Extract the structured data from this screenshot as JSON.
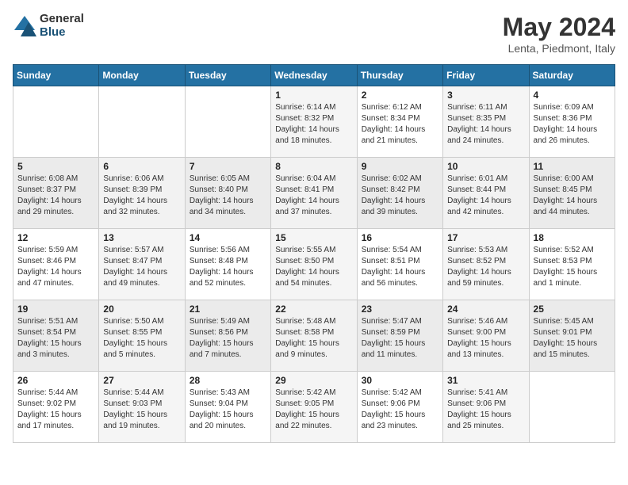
{
  "header": {
    "logo_general": "General",
    "logo_blue": "Blue",
    "title": "May 2024",
    "subtitle": "Lenta, Piedmont, Italy"
  },
  "days_of_week": [
    "Sunday",
    "Monday",
    "Tuesday",
    "Wednesday",
    "Thursday",
    "Friday",
    "Saturday"
  ],
  "weeks": [
    [
      {
        "day": "",
        "info": ""
      },
      {
        "day": "",
        "info": ""
      },
      {
        "day": "",
        "info": ""
      },
      {
        "day": "1",
        "info": "Sunrise: 6:14 AM\nSunset: 8:32 PM\nDaylight: 14 hours\nand 18 minutes."
      },
      {
        "day": "2",
        "info": "Sunrise: 6:12 AM\nSunset: 8:34 PM\nDaylight: 14 hours\nand 21 minutes."
      },
      {
        "day": "3",
        "info": "Sunrise: 6:11 AM\nSunset: 8:35 PM\nDaylight: 14 hours\nand 24 minutes."
      },
      {
        "day": "4",
        "info": "Sunrise: 6:09 AM\nSunset: 8:36 PM\nDaylight: 14 hours\nand 26 minutes."
      }
    ],
    [
      {
        "day": "5",
        "info": "Sunrise: 6:08 AM\nSunset: 8:37 PM\nDaylight: 14 hours\nand 29 minutes."
      },
      {
        "day": "6",
        "info": "Sunrise: 6:06 AM\nSunset: 8:39 PM\nDaylight: 14 hours\nand 32 minutes."
      },
      {
        "day": "7",
        "info": "Sunrise: 6:05 AM\nSunset: 8:40 PM\nDaylight: 14 hours\nand 34 minutes."
      },
      {
        "day": "8",
        "info": "Sunrise: 6:04 AM\nSunset: 8:41 PM\nDaylight: 14 hours\nand 37 minutes."
      },
      {
        "day": "9",
        "info": "Sunrise: 6:02 AM\nSunset: 8:42 PM\nDaylight: 14 hours\nand 39 minutes."
      },
      {
        "day": "10",
        "info": "Sunrise: 6:01 AM\nSunset: 8:44 PM\nDaylight: 14 hours\nand 42 minutes."
      },
      {
        "day": "11",
        "info": "Sunrise: 6:00 AM\nSunset: 8:45 PM\nDaylight: 14 hours\nand 44 minutes."
      }
    ],
    [
      {
        "day": "12",
        "info": "Sunrise: 5:59 AM\nSunset: 8:46 PM\nDaylight: 14 hours\nand 47 minutes."
      },
      {
        "day": "13",
        "info": "Sunrise: 5:57 AM\nSunset: 8:47 PM\nDaylight: 14 hours\nand 49 minutes."
      },
      {
        "day": "14",
        "info": "Sunrise: 5:56 AM\nSunset: 8:48 PM\nDaylight: 14 hours\nand 52 minutes."
      },
      {
        "day": "15",
        "info": "Sunrise: 5:55 AM\nSunset: 8:50 PM\nDaylight: 14 hours\nand 54 minutes."
      },
      {
        "day": "16",
        "info": "Sunrise: 5:54 AM\nSunset: 8:51 PM\nDaylight: 14 hours\nand 56 minutes."
      },
      {
        "day": "17",
        "info": "Sunrise: 5:53 AM\nSunset: 8:52 PM\nDaylight: 14 hours\nand 59 minutes."
      },
      {
        "day": "18",
        "info": "Sunrise: 5:52 AM\nSunset: 8:53 PM\nDaylight: 15 hours\nand 1 minute."
      }
    ],
    [
      {
        "day": "19",
        "info": "Sunrise: 5:51 AM\nSunset: 8:54 PM\nDaylight: 15 hours\nand 3 minutes."
      },
      {
        "day": "20",
        "info": "Sunrise: 5:50 AM\nSunset: 8:55 PM\nDaylight: 15 hours\nand 5 minutes."
      },
      {
        "day": "21",
        "info": "Sunrise: 5:49 AM\nSunset: 8:56 PM\nDaylight: 15 hours\nand 7 minutes."
      },
      {
        "day": "22",
        "info": "Sunrise: 5:48 AM\nSunset: 8:58 PM\nDaylight: 15 hours\nand 9 minutes."
      },
      {
        "day": "23",
        "info": "Sunrise: 5:47 AM\nSunset: 8:59 PM\nDaylight: 15 hours\nand 11 minutes."
      },
      {
        "day": "24",
        "info": "Sunrise: 5:46 AM\nSunset: 9:00 PM\nDaylight: 15 hours\nand 13 minutes."
      },
      {
        "day": "25",
        "info": "Sunrise: 5:45 AM\nSunset: 9:01 PM\nDaylight: 15 hours\nand 15 minutes."
      }
    ],
    [
      {
        "day": "26",
        "info": "Sunrise: 5:44 AM\nSunset: 9:02 PM\nDaylight: 15 hours\nand 17 minutes."
      },
      {
        "day": "27",
        "info": "Sunrise: 5:44 AM\nSunset: 9:03 PM\nDaylight: 15 hours\nand 19 minutes."
      },
      {
        "day": "28",
        "info": "Sunrise: 5:43 AM\nSunset: 9:04 PM\nDaylight: 15 hours\nand 20 minutes."
      },
      {
        "day": "29",
        "info": "Sunrise: 5:42 AM\nSunset: 9:05 PM\nDaylight: 15 hours\nand 22 minutes."
      },
      {
        "day": "30",
        "info": "Sunrise: 5:42 AM\nSunset: 9:06 PM\nDaylight: 15 hours\nand 23 minutes."
      },
      {
        "day": "31",
        "info": "Sunrise: 5:41 AM\nSunset: 9:06 PM\nDaylight: 15 hours\nand 25 minutes."
      },
      {
        "day": "",
        "info": ""
      }
    ]
  ]
}
